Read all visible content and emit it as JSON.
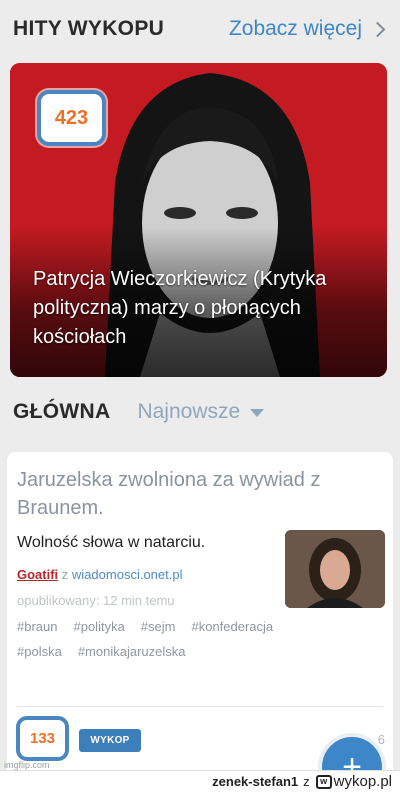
{
  "header": {
    "title": "HITY WYKOPU",
    "see_more": "Zobacz więcej"
  },
  "hero": {
    "score": "423",
    "title": "Patrycja Wieczorkiewicz (Krytyka polityczna) marzy o płonących kościołach"
  },
  "section": {
    "title": "GŁÓWNA",
    "sort": "Najnowsze"
  },
  "card": {
    "title": "Jaruzelska zwolniona za wywiad z Braunem.",
    "description": "Wolność słowa w natarciu.",
    "author": "Goatifi",
    "source_prefix": "z",
    "source": "wiadomosci.onet.pl",
    "published": "opublikowany: 12 min temu",
    "tags": [
      "#braun",
      "#polityka",
      "#sejm",
      "#konfederacja",
      "#polska",
      "#monikajaruzelska"
    ],
    "score": "133",
    "wykop_button": "WYKOP",
    "comments": "6"
  },
  "fab": {
    "label": "+"
  },
  "watermark": "imgflip.com",
  "footer": {
    "user": "zenek-stefan1",
    "from": "z",
    "brand": "wykop.pl"
  },
  "colors": {
    "accent": "#3d7fba",
    "score": "#ee6f26",
    "author": "#b8262b",
    "hero_red": "#c51b23"
  }
}
